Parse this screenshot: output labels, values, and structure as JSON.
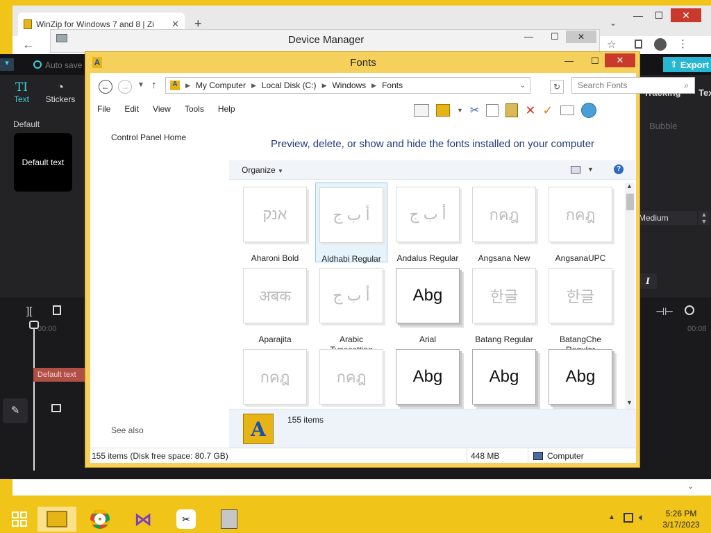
{
  "chrome": {
    "tab_title": "WinZip for Windows 7 and 8 | Zi",
    "new_tab": "+",
    "tab_chevron": "⌄",
    "minimize": "—",
    "maximize": "☐",
    "close": "✕"
  },
  "device_manager": {
    "title": "Device Manager"
  },
  "capcut": {
    "autosave": "Auto save",
    "export": "Export",
    "tabs": [
      {
        "icon": "TI",
        "label": "Text"
      },
      {
        "icon": "◔",
        "label": "Stickers"
      }
    ],
    "right_tabs": {
      "tracking": "Tracking",
      "text": "Tex"
    },
    "section": "Default",
    "preset_label": "Default text",
    "bubble": "Bubble",
    "medium": "Medium",
    "italic": "I",
    "timecode_start": "00:00",
    "timecode_end": "00:08",
    "clip_label": "Default text"
  },
  "fonts_window": {
    "title": "Fonts",
    "address": {
      "segments": [
        "My Computer",
        "Local Disk (C:)",
        "Windows",
        "Fonts"
      ]
    },
    "search_placeholder": "Search Fonts",
    "menu": [
      "File",
      "Edit",
      "View",
      "Tools",
      "Help"
    ],
    "nav": {
      "home": "Control Panel Home",
      "see_also": "See also"
    },
    "headline": "Preview, delete, or show and hide the fonts installed on your computer",
    "organize": "Organize",
    "fonts": [
      {
        "name": "Aharoni Bold",
        "preview": "אנק",
        "dark": false,
        "selected": false
      },
      {
        "name": "Aldhabi Regular",
        "preview": "أ ب ج",
        "dark": false,
        "selected": true
      },
      {
        "name": "Andalus Regular",
        "preview": "أ ب ج",
        "dark": false,
        "selected": false
      },
      {
        "name": "Angsana New",
        "preview": "กคฎ",
        "dark": false,
        "selected": false
      },
      {
        "name": "AngsanaUPC",
        "preview": "กคฎ",
        "dark": false,
        "selected": false
      },
      {
        "name": "Aparajita",
        "preview": "अबक",
        "dark": false,
        "selected": false
      },
      {
        "name": "Arabic Typesetting Regular",
        "preview": "أ ب ج",
        "dark": false,
        "selected": false
      },
      {
        "name": "Arial",
        "preview": "Abg",
        "dark": true,
        "selected": false
      },
      {
        "name": "Batang Regular",
        "preview": "한글",
        "dark": false,
        "selected": false
      },
      {
        "name": "BatangChe Regular",
        "preview": "한글",
        "dark": false,
        "selected": false
      },
      {
        "name": "",
        "preview": "กคฎ",
        "dark": false,
        "selected": false
      },
      {
        "name": "",
        "preview": "กคฎ",
        "dark": false,
        "selected": false
      },
      {
        "name": "",
        "preview": "Abg",
        "dark": true,
        "selected": false
      },
      {
        "name": "",
        "preview": "Abg",
        "dark": true,
        "selected": false
      },
      {
        "name": "",
        "preview": "Abg",
        "dark": true,
        "selected": false
      }
    ],
    "details": {
      "count": "155 items"
    },
    "status": {
      "left": "155 items (Disk free space: 80.7 GB)",
      "size": "448 MB",
      "location": "Computer"
    }
  },
  "taskbar": {
    "time": "5:26 PM",
    "date": "3/17/2023"
  }
}
